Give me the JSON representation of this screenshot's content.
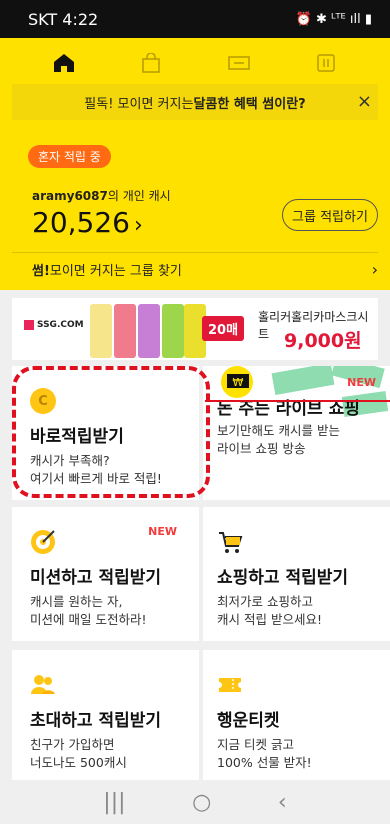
{
  "status_bar": {
    "time": "SKT 4:22",
    "indicators": "⏰ ✱ ᴸᵀᴱ ıll ▮"
  },
  "tabs": [
    {
      "icon": "home-icon"
    },
    {
      "icon": "shopping-bag-icon"
    },
    {
      "icon": "coupon-icon"
    },
    {
      "icon": "receipt-icon"
    }
  ],
  "banner": {
    "prefix": "필독! 모이면 커지는 ",
    "bold": "달콤한 혜택 썸이란?",
    "close": "×"
  },
  "cash": {
    "badge": "혼자 적립 중",
    "user_bold": "aramy6087",
    "user_suffix": "의 개인 캐시",
    "amount": "20,526",
    "chevron": "›",
    "group_button": "그룹 적립하기"
  },
  "find_group": {
    "bold": "썸!",
    "text": " 모이면 커지는 그룹 찾기",
    "chevron": "›"
  },
  "ad": {
    "logo": "SSG.COM",
    "badge": "20매",
    "title": "홀리커홀리카마스크시트",
    "price": "9,000원"
  },
  "cards": [
    {
      "title": "바로적립받기",
      "desc1": "캐시가 부족해?",
      "desc2": "여기서 빠르게 바로 적립!",
      "badge": "",
      "icon": "coin-icon"
    },
    {
      "title": "돈 주는 라이브 쇼핑",
      "desc1": "보기만해도 캐시를 받는",
      "desc2": "라이브 쇼핑 방송",
      "badge": "NEW",
      "icon": "money-icon"
    },
    {
      "title": "미션하고 적립받기",
      "desc1": "캐시를 원하는 자,",
      "desc2": "미션에 매일 도전하라!",
      "badge": "NEW",
      "icon": "target-icon"
    },
    {
      "title": "쇼핑하고 적립받기",
      "desc1": "최저가로 쇼핑하고",
      "desc2": "캐시 적립 받으세요!",
      "badge": "",
      "icon": "cart-icon"
    },
    {
      "title": "초대하고 적립받기",
      "desc1": "친구가 가입하면",
      "desc2": "너도나도 500캐시",
      "badge": "",
      "icon": "friends-icon"
    },
    {
      "title": "행운티켓",
      "desc1": "지금 티켓 긁고",
      "desc2": "100% 선물 받자!",
      "badge": "",
      "icon": "ticket-icon"
    }
  ],
  "nav": {
    "recent": "|||",
    "home": "○",
    "back": "‹"
  },
  "colors": {
    "brand_yellow": "#ffe100",
    "accent_orange": "#ff6a13",
    "new_red": "#f23b3b",
    "annotation_red": "#e0101e"
  }
}
